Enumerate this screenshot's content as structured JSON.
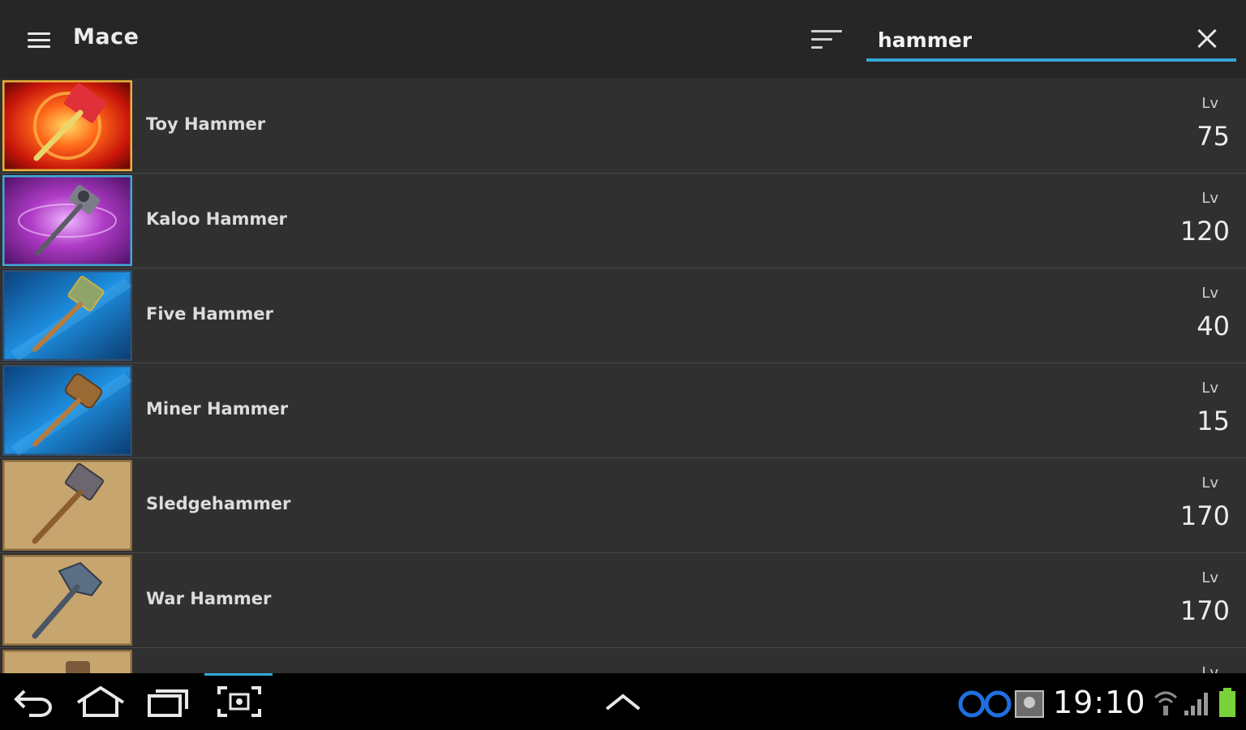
{
  "header": {
    "title": "Mace",
    "search_value": "hammer"
  },
  "items": [
    {
      "name": "Toy Hammer",
      "lv_label": "Lv",
      "lv": "75",
      "theme": "red"
    },
    {
      "name": "Kaloo Hammer",
      "lv_label": "Lv",
      "lv": "120",
      "theme": "purple"
    },
    {
      "name": "Five Hammer",
      "lv_label": "Lv",
      "lv": "40",
      "theme": "blue"
    },
    {
      "name": "Miner Hammer",
      "lv_label": "Lv",
      "lv": "15",
      "theme": "blue"
    },
    {
      "name": "Sledgehammer",
      "lv_label": "Lv",
      "lv": "170",
      "theme": "tan"
    },
    {
      "name": "War Hammer",
      "lv_label": "Lv",
      "lv": "170",
      "theme": "tan"
    },
    {
      "name": "",
      "lv_label": "Lv",
      "lv": "",
      "theme": "tan"
    }
  ],
  "statusbar": {
    "time": "19:10"
  },
  "colors": {
    "accent": "#33a6d6",
    "header_bg": "#262626",
    "row_bg": "#303030"
  },
  "icons": {
    "menu": "hamburger-icon",
    "sort": "sort-icon",
    "clear": "close-icon",
    "back": "back-icon",
    "home": "home-icon",
    "recent": "recent-apps-icon",
    "screenshot": "screenshot-icon",
    "up": "chevron-up-icon",
    "wifi": "wifi-icon",
    "signal": "signal-icon",
    "battery": "battery-icon"
  }
}
